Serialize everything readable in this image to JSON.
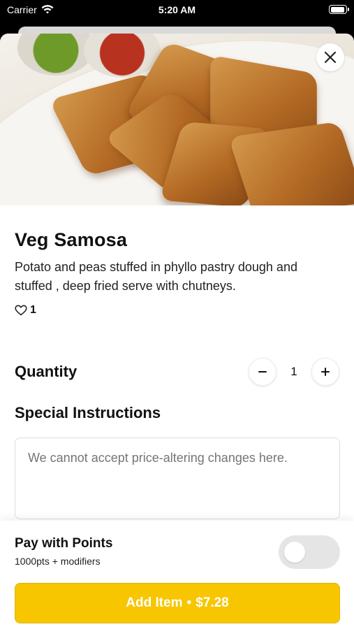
{
  "status_bar": {
    "carrier": "Carrier",
    "time": "5:20 AM"
  },
  "item": {
    "title": "Veg Samosa",
    "description": "Potato and peas stuffed in phyllo pastry dough and stuffed , deep fried serve with chutneys.",
    "likes": "1",
    "image_icon": "samosa-photo"
  },
  "quantity": {
    "label": "Quantity",
    "value": "1",
    "decrement_icon": "minus-icon",
    "increment_icon": "plus-icon"
  },
  "instructions": {
    "label": "Special Instructions",
    "placeholder": "We cannot accept price-altering changes here."
  },
  "points": {
    "title": "Pay with Points",
    "subtitle": "1000pts + modifiers",
    "enabled": false
  },
  "add_button": {
    "label": "Add Item",
    "separator": "•",
    "price": "$7.28"
  },
  "colors": {
    "accent": "#f7c600",
    "toggle_off": "#e5e5e5"
  }
}
